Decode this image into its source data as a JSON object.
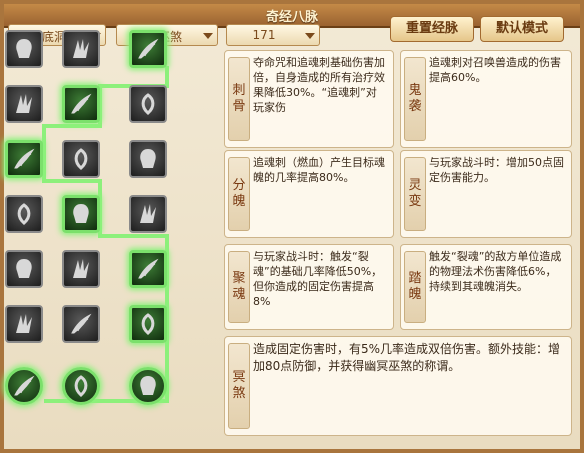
{
  "window": {
    "title": "奇经八脉"
  },
  "dropdowns": [
    {
      "label": "无底洞"
    },
    {
      "label": "幽冥巫煞"
    },
    {
      "label": "171"
    }
  ],
  "buttons": {
    "reset": "重置经脉",
    "default_mode": "默认模式"
  },
  "colors": {
    "active_green": "#7be06b",
    "frame_brown": "#a9753d",
    "label_brown": "#7a3a12"
  },
  "grid": {
    "rows": [
      [
        {
          "icon": "skull-mask-icon",
          "active": false
        },
        {
          "icon": "claw-icon",
          "active": false
        },
        {
          "icon": "leaf-blade-icon",
          "active": true
        }
      ],
      [
        {
          "icon": "horn-icon",
          "active": false
        },
        {
          "icon": "spirit-hand-icon",
          "active": true
        },
        {
          "icon": "wing-icon",
          "active": false
        }
      ],
      [
        {
          "icon": "ghost-face-icon",
          "active": true
        },
        {
          "icon": "demon-icon",
          "active": false
        },
        {
          "icon": "vortex-icon",
          "active": false
        }
      ],
      [
        {
          "icon": "bone-icon",
          "active": false
        },
        {
          "icon": "swirl-icon",
          "active": true
        },
        {
          "icon": "shadow-figure-icon",
          "active": false
        }
      ],
      [
        {
          "icon": "blade-icon",
          "active": false
        },
        {
          "icon": "mask-icon",
          "active": false
        },
        {
          "icon": "eye-swirl-icon",
          "active": true
        }
      ],
      [
        {
          "icon": "skull-icon",
          "active": false
        },
        {
          "icon": "scroll-icon",
          "active": false
        },
        {
          "icon": "flame-icon",
          "active": true
        }
      ],
      [
        {
          "icon": "spiral-orb-icon",
          "active": true
        },
        {
          "icon": "fist-icon",
          "active": true
        },
        {
          "icon": "coil-orb-icon",
          "active": true
        }
      ]
    ]
  },
  "skills": {
    "ci_gu": {
      "name": "刺骨",
      "desc": "夺命咒和追魂刺基础伤害加倍，自身造成的所有治疗效果降低30%。“追魂刺”对玩家伤"
    },
    "gui_xi": {
      "name": "鬼袭",
      "desc": "追魂刺对召唤兽造成的伤害提高60%。"
    },
    "fen_po": {
      "name": "分魄",
      "desc": "追魂刺（燃血）产生目标魂魄的几率提高80%。"
    },
    "ling_bian": {
      "name": "灵变",
      "desc": "与玩家战斗时：增加50点固定伤害能力。"
    },
    "ju_hun": {
      "name": "聚魂",
      "desc": "与玩家战斗时：触发“裂魂”的基础几率降低50%，但你造成的固定伤害提高8%"
    },
    "ta_po": {
      "name": "踏魄",
      "desc": "触发“裂魂”的敌方单位造成的物理法术伤害降低6%，持续到其魂魄消失。"
    },
    "ming_sha": {
      "name": "冥煞",
      "desc": "造成固定伤害时，有5%几率造成双倍伤害。额外技能：增加80点防御，并获得幽冥巫煞的称谓。"
    }
  }
}
